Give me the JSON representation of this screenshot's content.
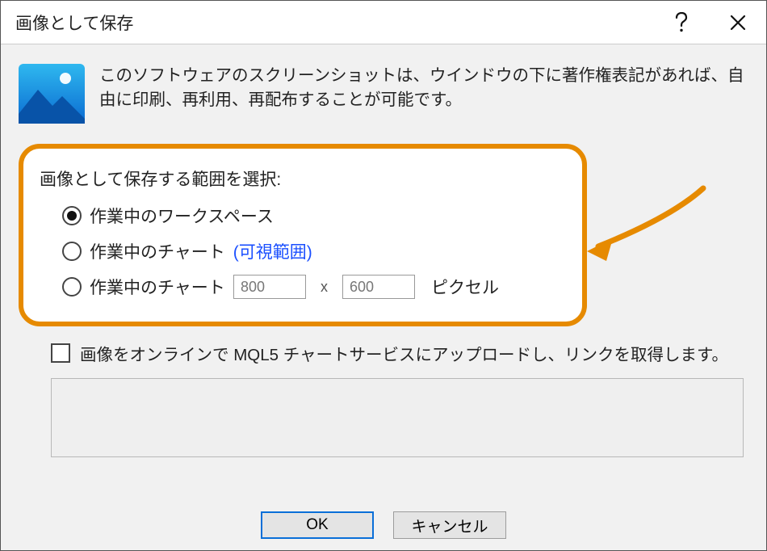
{
  "titlebar": {
    "title": "画像として保存"
  },
  "info": {
    "text": "このソフトウェアのスクリーンショットは、ウインドウの下に著作権表記があれば、自由に印刷、再利用、再配布することが可能です。"
  },
  "range": {
    "heading": "画像として保存する範囲を選択:",
    "option_workspace": "作業中のワークスペース",
    "option_chart_visible_prefix": "作業中のチャート",
    "option_chart_visible_paren": "(可視範囲)",
    "option_chart_size_label": "作業中のチャート",
    "width_value": "800",
    "height_value": "600",
    "x_separator": "x",
    "pixels_label": "ピクセル",
    "selected": "workspace"
  },
  "upload": {
    "label": "画像をオンラインで MQL5 チャートサービスにアップロードし、リンクを取得します。"
  },
  "buttons": {
    "ok": "OK",
    "cancel": "キャンセル"
  }
}
